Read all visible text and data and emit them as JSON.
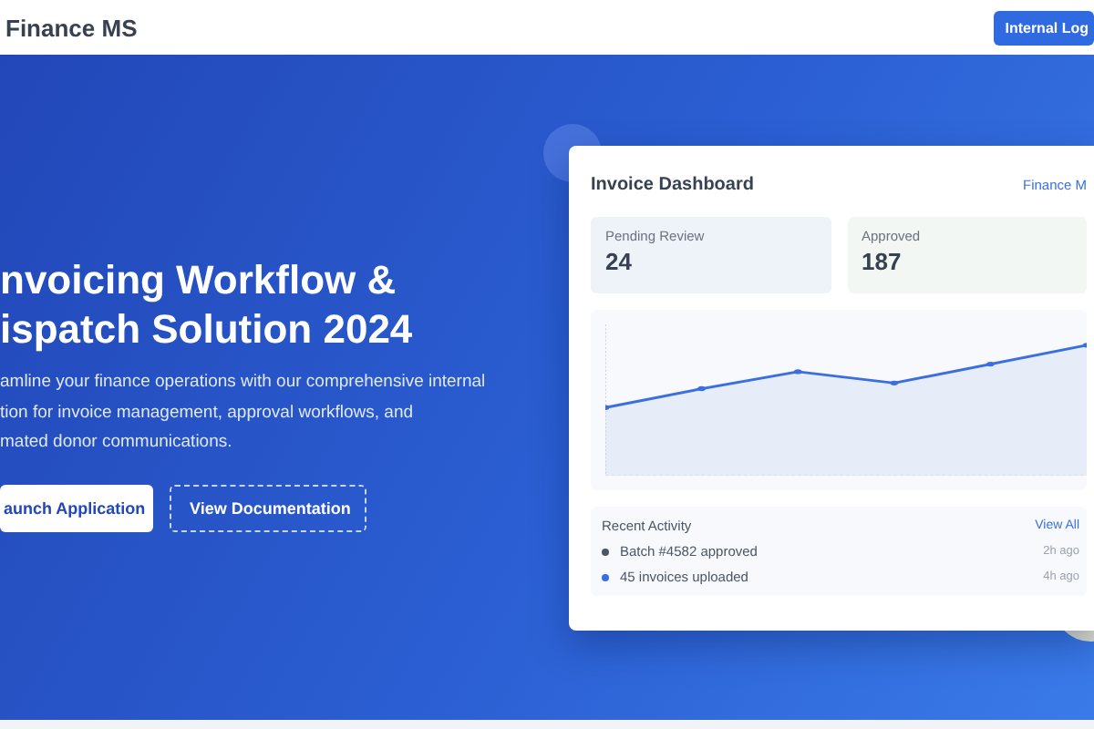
{
  "header": {
    "brand": "Finance MS",
    "login_button": "Internal Log"
  },
  "hero": {
    "title_lines": [
      "nvoicing Workflow &",
      "ispatch Solution 2024"
    ],
    "description_lines": [
      "amline your finance operations with our comprehensive internal",
      "tion for invoice management, approval workflows, and",
      "mated donor communications."
    ],
    "buttons": [
      {
        "label": "aunch Application",
        "kind": "primary"
      },
      {
        "label": "View Documentation",
        "kind": "outline"
      }
    ]
  },
  "dashboard": {
    "title": "Invoice Dashboard",
    "brand": "Finance M",
    "stats": [
      {
        "label": "Pending Review",
        "value": "24"
      },
      {
        "label": "Approved",
        "value": "187"
      }
    ],
    "activity": {
      "title": "Recent Activity",
      "link": "View All",
      "items": [
        {
          "text": "Batch #4582 approved",
          "time": "2h ago",
          "color": "#4b5563"
        },
        {
          "text": "45 invoices uploaded",
          "time": "4h ago",
          "color": "#3b6fe0"
        }
      ]
    }
  }
}
